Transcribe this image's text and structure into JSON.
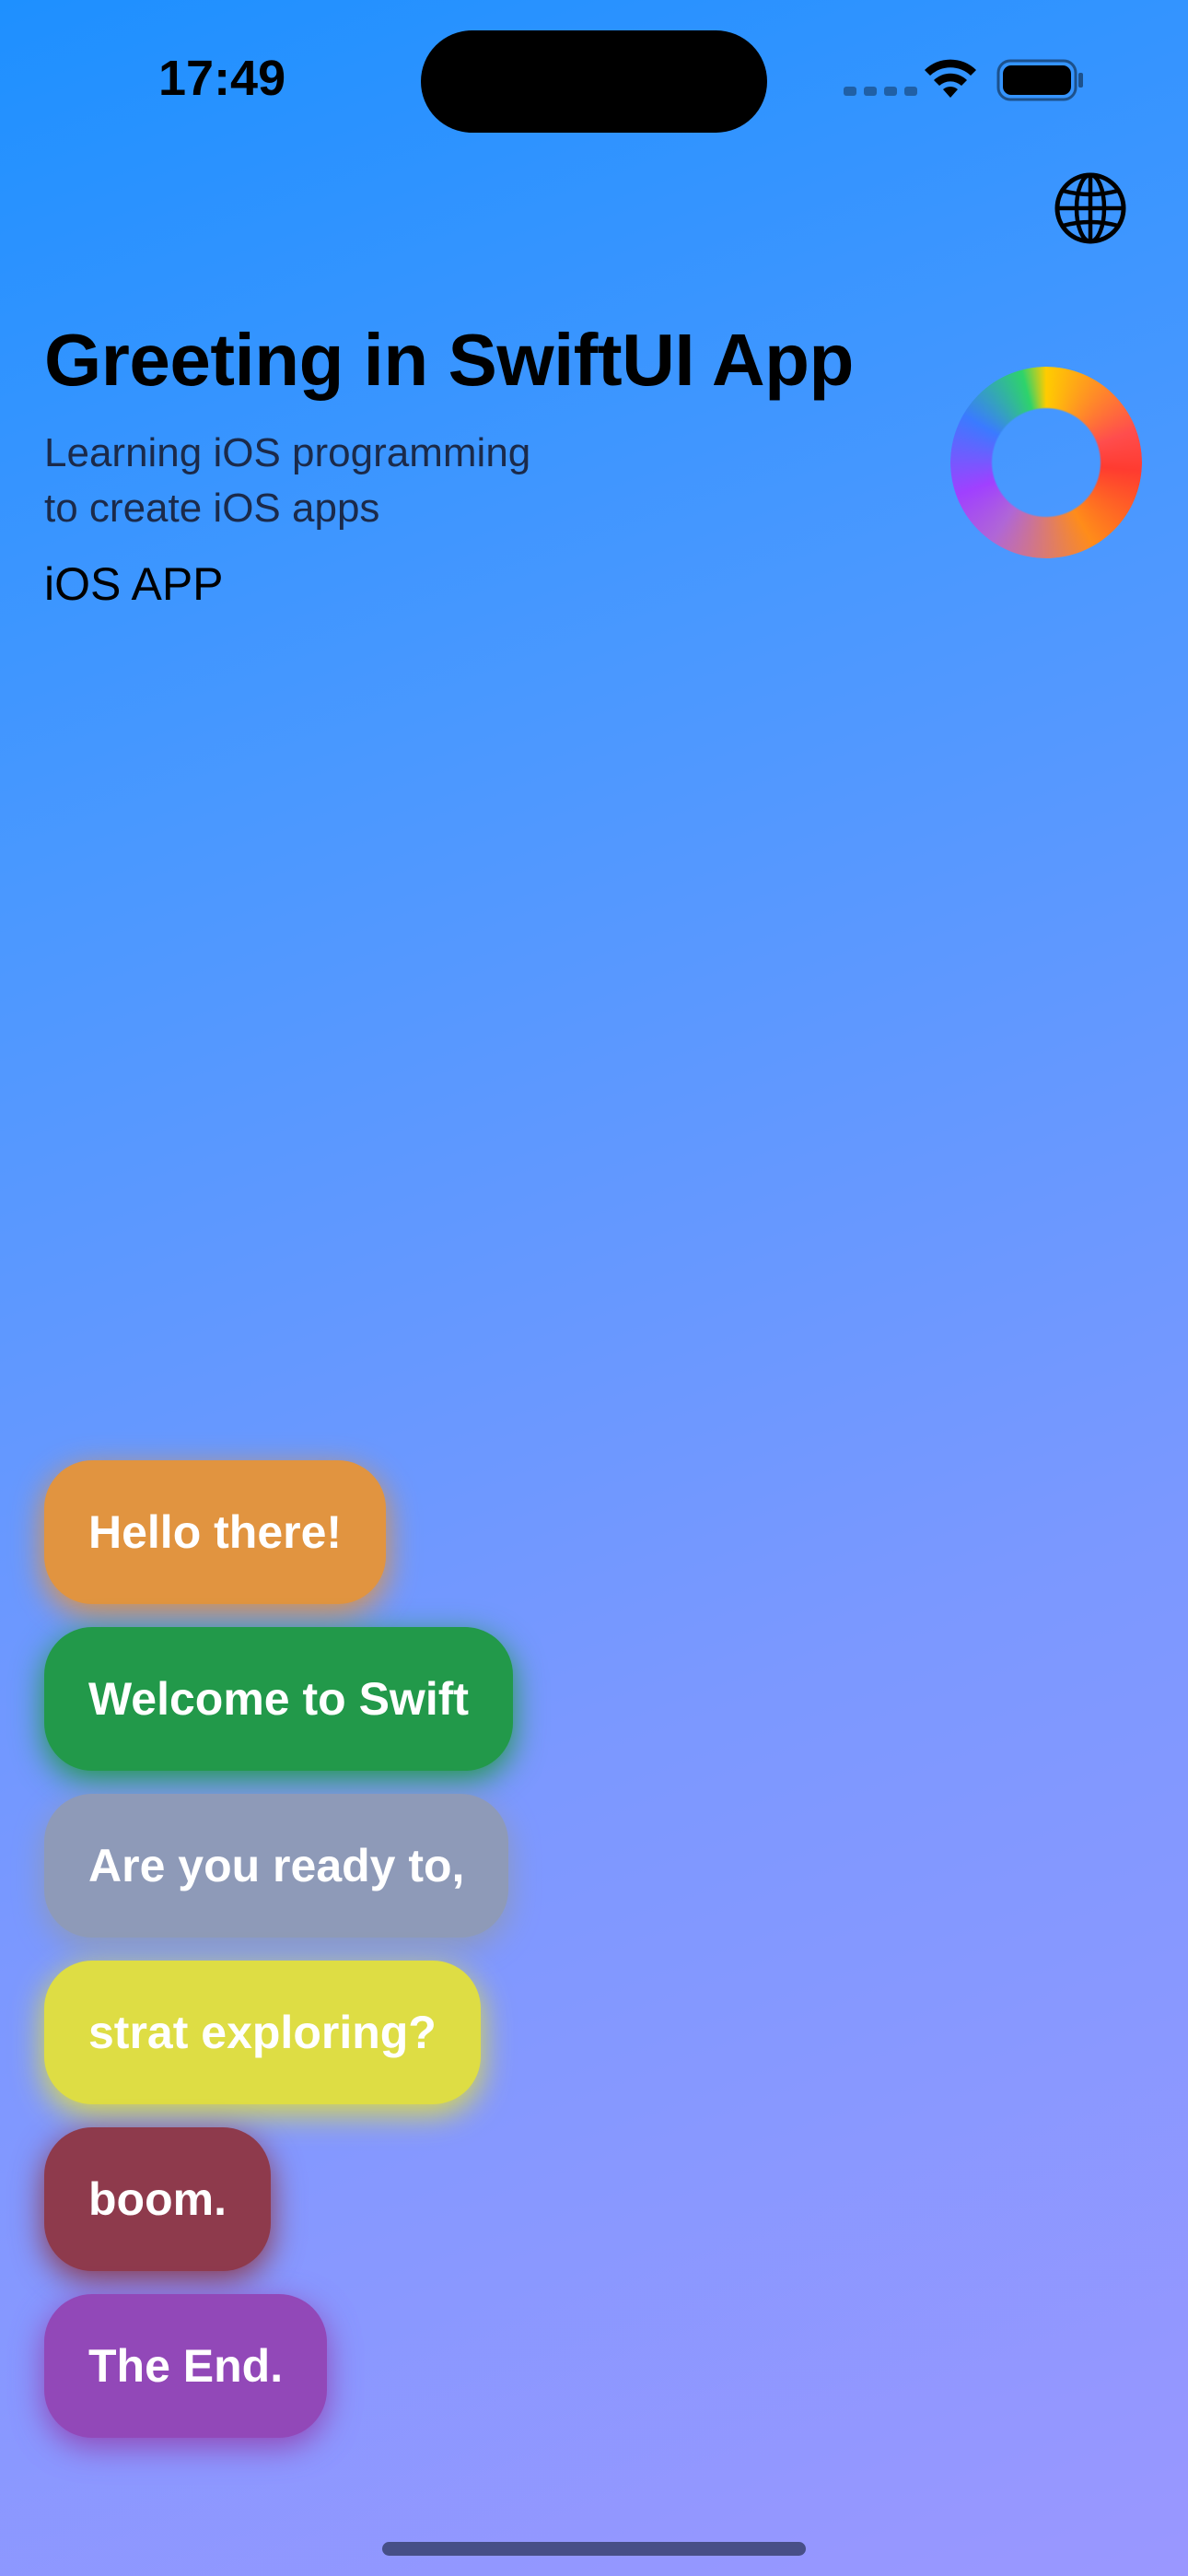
{
  "status_bar": {
    "time": "17:49",
    "icons": [
      "cellular-icon",
      "wifi-icon",
      "battery-icon"
    ]
  },
  "toolbar": {
    "globe_icon": "globe-icon"
  },
  "header": {
    "title": "Greeting in SwiftUI App",
    "subtitle_lines": [
      "Learning iOS programming",
      "to create iOS apps"
    ],
    "app_label": "iOS APP"
  },
  "bubbles": [
    {
      "text": "Hello there!",
      "color": "#e19440"
    },
    {
      "text": "Welcome to Swift",
      "color": "#22994a"
    },
    {
      "text": "Are you ready to,",
      "color": "#8e9ab8"
    },
    {
      "text": "strat exploring?",
      "color": "#dedd44"
    },
    {
      "text": "boom.",
      "color": "#8e3a4c"
    },
    {
      "text": "The End.",
      "color": "#9248b8"
    }
  ],
  "colors": {
    "background_top": "#1e90ff",
    "background_bottom": "#9a97ff"
  }
}
